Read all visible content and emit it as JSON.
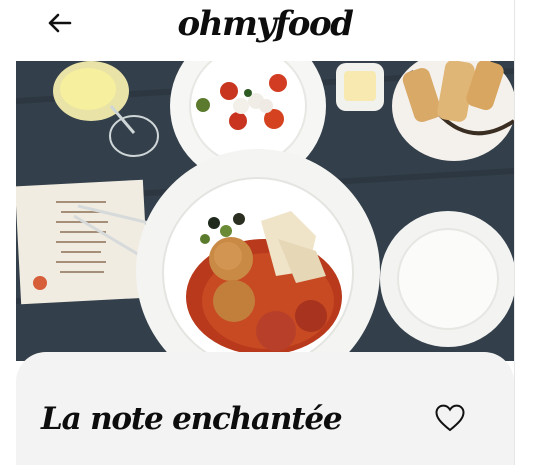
{
  "header": {
    "back_icon": "arrow-left-icon",
    "brand": "ohmyfood"
  },
  "hero": {
    "description_icon": "food-photo"
  },
  "restaurant": {
    "name": "La note enchantée",
    "favorite_icon": "heart-outline-icon"
  },
  "colors": {
    "text": "#0d0d0d",
    "card_background": "#f3f3f3",
    "page_background": "#ffffff",
    "table": "#2f3b45"
  }
}
